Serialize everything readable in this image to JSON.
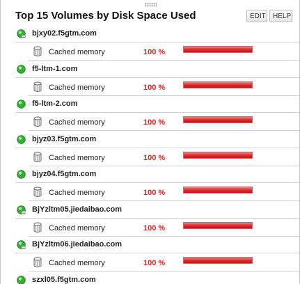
{
  "widget": {
    "title": "Top 15 Volumes by Disk Space Used",
    "edit_label": "EDIT",
    "help_label": "HELP"
  },
  "colors": {
    "status_up": "#2fb02f",
    "percent_text": "#e02020",
    "bar_fill": "#d82828"
  },
  "hosts": [
    {
      "name": "bjxy02.f5gtm.com",
      "icon": "node-up-with-badge-icon",
      "volumes": [
        {
          "name": "Cached memory",
          "percent": "100 %",
          "fill": 1.0
        }
      ]
    },
    {
      "name": "f5-ltm-1.com",
      "icon": "node-up-icon",
      "volumes": [
        {
          "name": "Cached memory",
          "percent": "100 %",
          "fill": 1.0
        }
      ]
    },
    {
      "name": "f5-ltm-2.com",
      "icon": "node-up-icon",
      "volumes": [
        {
          "name": "Cached memory",
          "percent": "100 %",
          "fill": 1.0
        }
      ]
    },
    {
      "name": "bjyz03.f5gtm.com",
      "icon": "node-up-icon",
      "volumes": [
        {
          "name": "Cached memory",
          "percent": "100 %",
          "fill": 1.0
        }
      ]
    },
    {
      "name": "bjyz04.f5gtm.com",
      "icon": "node-up-icon",
      "volumes": [
        {
          "name": "Cached memory",
          "percent": "100 %",
          "fill": 1.0
        }
      ]
    },
    {
      "name": "BjYzltm05.jiedaibao.com",
      "icon": "node-up-with-badge-icon",
      "volumes": [
        {
          "name": "Cached memory",
          "percent": "100 %",
          "fill": 1.0
        }
      ]
    },
    {
      "name": "BjYzltm06.jiedaibao.com",
      "icon": "node-up-with-badge-icon",
      "volumes": [
        {
          "name": "Cached memory",
          "percent": "100 %",
          "fill": 1.0
        }
      ]
    },
    {
      "name": "szxl05.f5gtm.com",
      "icon": "node-up-icon",
      "volumes": []
    }
  ]
}
